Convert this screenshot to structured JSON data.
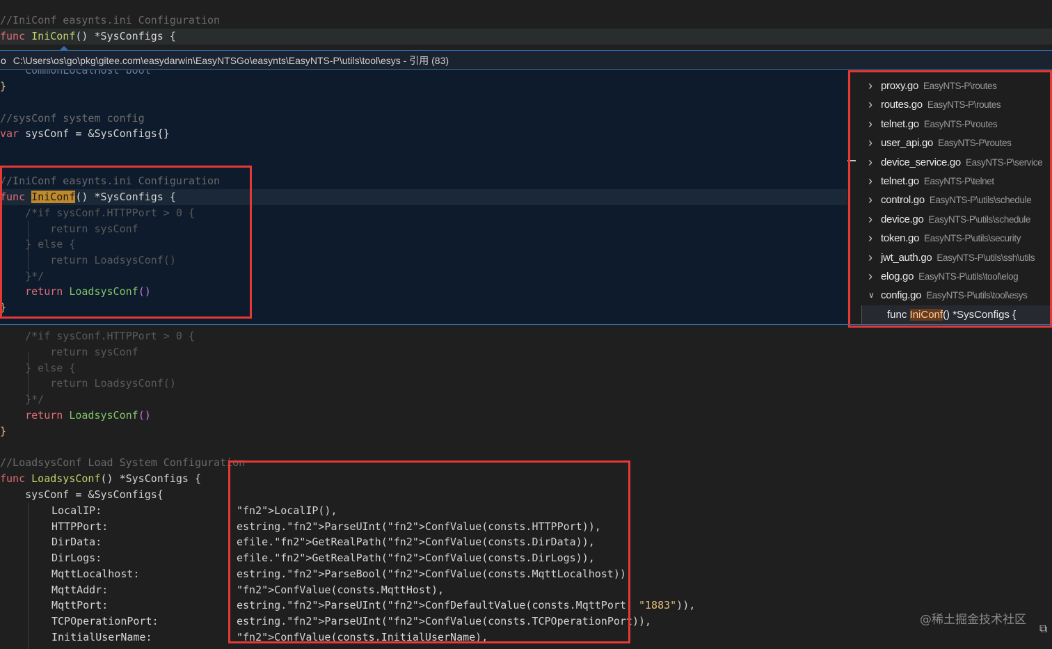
{
  "sticky": {
    "comment": "//IniConf easynts.ini Configuration",
    "kw": "func",
    "fn": "IniConf",
    "rest": "() *SysConfigs {"
  },
  "peek_header": {
    "path": "C:\\Users\\os\\go\\pkg\\gitee.com\\easydarwin\\EasyNTSGo\\easynts\\EasyNTS-P\\utils\\tool\\esys - 引用 (83)",
    "prefix": "o"
  },
  "peek_code": {
    "l0": "    CommonLocalHost bool",
    "l1": "}",
    "l3": "//sysConf system config",
    "l4_kw": "var",
    "l4_rest": " sysConf = &SysConfigs{}",
    "l7": "//IniConf easynts.ini Configuration",
    "l8_kw": "func",
    "l8_fn": "IniConf",
    "l8_rest": "() *SysConfigs {",
    "l9": "    /*if sysConf.HTTPPort > 0 {",
    "l10": "        return sysConf",
    "l11": "    } else {",
    "l12": "        return LoadsysConf()",
    "l13": "    }*/",
    "l14_kw": "    return",
    "l14_fn": "LoadsysConf",
    "l14_rest": "()",
    "l15": "}"
  },
  "references": {
    "items": [
      {
        "name": "proxy.go",
        "path": "EasyNTS-P\\routes",
        "expanded": false
      },
      {
        "name": "routes.go",
        "path": "EasyNTS-P\\routes",
        "expanded": false
      },
      {
        "name": "telnet.go",
        "path": "EasyNTS-P\\routes",
        "expanded": false
      },
      {
        "name": "user_api.go",
        "path": "EasyNTS-P\\routes",
        "expanded": false
      },
      {
        "name": "device_service.go",
        "path": "EasyNTS-P\\service",
        "expanded": false
      },
      {
        "name": "telnet.go",
        "path": "EasyNTS-P\\telnet",
        "expanded": false
      },
      {
        "name": "control.go",
        "path": "EasyNTS-P\\utils\\schedule",
        "expanded": false
      },
      {
        "name": "device.go",
        "path": "EasyNTS-P\\utils\\schedule",
        "expanded": false
      },
      {
        "name": "token.go",
        "path": "EasyNTS-P\\utils\\security",
        "expanded": false
      },
      {
        "name": "jwt_auth.go",
        "path": "EasyNTS-P\\utils\\ssh\\utils",
        "expanded": false
      },
      {
        "name": "elog.go",
        "path": "EasyNTS-P\\utils\\tool\\elog",
        "expanded": false
      },
      {
        "name": "config.go",
        "path": "EasyNTS-P\\utils\\tool\\esys",
        "expanded": true
      }
    ],
    "child": {
      "pre": "func ",
      "match": "IniConf",
      "post": "() *SysConfigs {"
    }
  },
  "main_code": {
    "m0": "    /*if sysConf.HTTPPort > 0 {",
    "m1": "        return sysConf",
    "m2": "    } else {",
    "m3": "        return LoadsysConf()",
    "m4": "    }*/",
    "m5_kw": "    return",
    "m5_fn": "LoadsysConf",
    "m5_rest": "()",
    "m6": "}",
    "m8": "//LoadsysConf Load System Configuration",
    "m9_kw": "func",
    "m9_fn": "LoadsysConf",
    "m9_rest": "() *SysConfigs {",
    "m10": "    sysConf = &SysConfigs{",
    "fields": [
      {
        "name": "LocalIP:",
        "value": "LocalIP(),"
      },
      {
        "name": "HTTPPort:",
        "value": "estring.ParseUInt(ConfValue(consts.HTTPPort)),"
      },
      {
        "name": "DirData:",
        "value": "efile.GetRealPath(ConfValue(consts.DirData)),"
      },
      {
        "name": "DirLogs:",
        "value": "efile.GetRealPath(ConfValue(consts.DirLogs)),"
      },
      {
        "name": "MqttLocalhost:",
        "value": "estring.ParseBool(ConfValue(consts.MqttLocalhost)),"
      },
      {
        "name": "MqttAddr:",
        "value": "ConfValue(consts.MqttHost),"
      },
      {
        "name": "MqttPort:",
        "value": "estring.ParseUInt(ConfDefaultValue(consts.MqttPort, \"1883\")),"
      },
      {
        "name": "TCPOperationPort:",
        "value": "estring.ParseUInt(ConfValue(consts.TCPOperationPort)),"
      },
      {
        "name": "InitialUserName:",
        "value": "ConfValue(consts.InitialUserName),"
      }
    ]
  },
  "watermark": "@稀土掘金技术社区"
}
